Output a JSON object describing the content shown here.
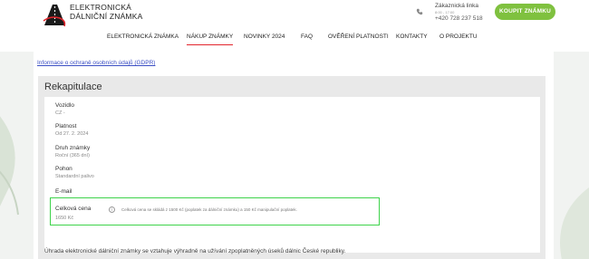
{
  "header": {
    "brand_line1": "ELEKTRONICKÁ",
    "brand_line2": "DÁLNIČNÍ ZNÁMKA",
    "support_label": "Zákaznická linka",
    "support_hours": "8:00 - 17:00",
    "support_phone": "+420 728 237 518",
    "buy_button": "KOUPIT ZNÁMKU",
    "brand_color": "#e2262d",
    "accent_color": "#7fc13f"
  },
  "nav": {
    "items": [
      {
        "label": "ELEKTRONICKÁ ZNÁMKA"
      },
      {
        "label": "NÁKUP ZNÁMKY"
      },
      {
        "label": "NOVINKY 2024"
      },
      {
        "label": "FAQ"
      },
      {
        "label": "OVĚŘENÍ PLATNOSTI"
      },
      {
        "label": "KONTAKTY"
      },
      {
        "label": "O PROJEKTU"
      }
    ],
    "active_index": 1
  },
  "main": {
    "gdpr_link": "Informace o ochraně osobních údajů (GDPR)",
    "recap": {
      "title": "Rekapitulace",
      "fields": [
        {
          "label": "Vozidlo",
          "value": "CZ -"
        },
        {
          "label": "Platnost",
          "value": "Od 27. 2. 2024"
        },
        {
          "label": "Druh známky",
          "value": "Roční (365 dní)"
        },
        {
          "label": "Pohon",
          "value": "Standardní palivo"
        },
        {
          "label": "E-mail",
          "value": ""
        }
      ],
      "total": {
        "label": "Celková cena",
        "value": "1650 Kč",
        "note": "Celková cena se skládá z 1500 Kč (poplatek za dálniční známku) a 150 Kč manipulační poplatek."
      }
    },
    "footer_note": "Úhrada elektronické dálniční známky se vztahuje výhradně na užívání zpoplatněných úseků dálnic České republiky."
  }
}
